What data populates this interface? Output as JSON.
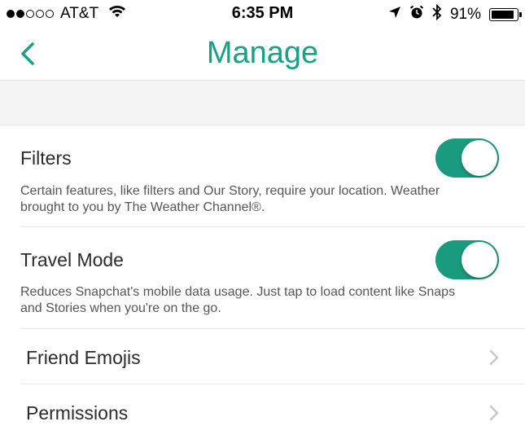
{
  "status_bar": {
    "signal_full_dots": 2,
    "signal_total_dots": 5,
    "carrier": "AT&T",
    "time": "6:35 PM",
    "battery_percent_label": "91%",
    "battery_level": 0.91
  },
  "nav": {
    "title": "Manage",
    "back_icon": "chevron-left-icon"
  },
  "settings": {
    "filters": {
      "title": "Filters",
      "description": "Certain features, like filters and Our Story, require your location. Weather brought to you by The Weather Channel®.",
      "enabled": true
    },
    "travel_mode": {
      "title": "Travel Mode",
      "description": "Reduces Snapchat's mobile data usage. Just tap to load content like Snaps and Stories when you're on the go.",
      "enabled": true
    },
    "friend_emojis": {
      "title": "Friend Emojis"
    },
    "permissions": {
      "title": "Permissions"
    }
  },
  "colors": {
    "accent": "#15a286",
    "toggle_on": "#1a9b7f",
    "band": "#f4f4f4"
  }
}
